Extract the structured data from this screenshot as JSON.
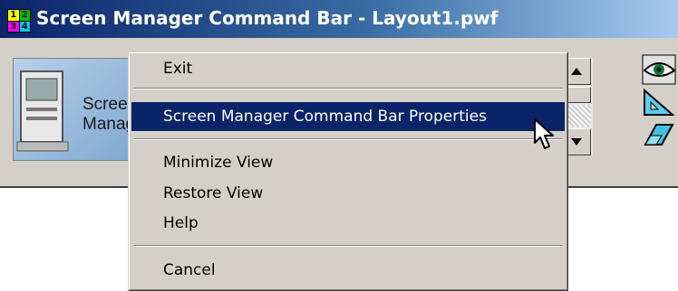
{
  "window": {
    "title": "Screen Manager Command Bar - Layout1.pwf",
    "app_icon_digits": [
      "1",
      "2",
      "3",
      "4"
    ]
  },
  "logo": {
    "text_line1": "Scree",
    "text_line2": "Manag"
  },
  "context_menu": {
    "items": [
      {
        "label": "Exit"
      },
      {
        "label": "Screen Manager Command Bar Properties",
        "highlighted": true
      },
      {
        "label": "Minimize View"
      },
      {
        "label": "Restore View"
      },
      {
        "label": "Help"
      },
      {
        "label": "Cancel"
      }
    ]
  },
  "colors": {
    "title_start": "#0a246a",
    "title_end": "#a6caf0",
    "highlight": "#0a246a",
    "face": "#d4d0c8"
  },
  "icons": [
    "app-icon",
    "computer-icon",
    "scroll-up-arrow-icon",
    "scroll-down-arrow-icon",
    "eye-icon",
    "ruler-triangle-icon",
    "eraser-icon",
    "mouse-pointer-icon"
  ]
}
